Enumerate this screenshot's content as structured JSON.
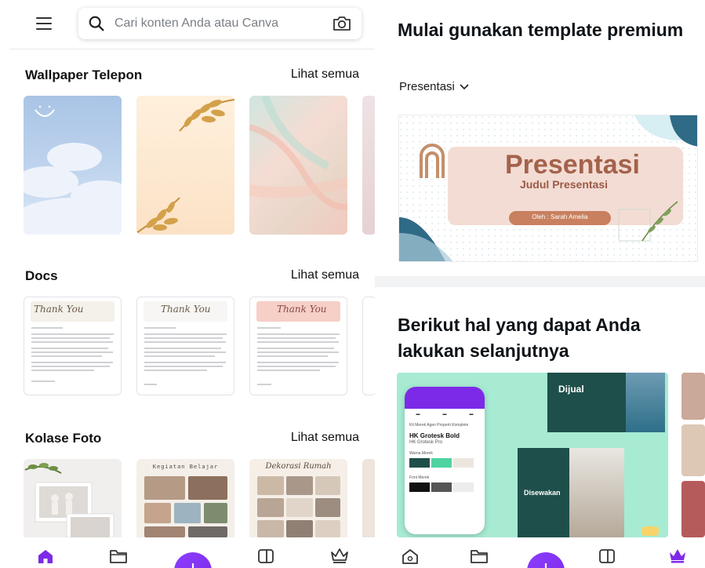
{
  "left": {
    "search": {
      "placeholder": "Cari konten Anda atau Canva"
    },
    "sections": [
      {
        "title": "Wallpaper Telepon",
        "see_all": "Lihat semua"
      },
      {
        "title": "Docs",
        "see_all": "Lihat semua"
      },
      {
        "title": "Kolase Foto",
        "see_all": "Lihat semua"
      }
    ],
    "docs": [
      {
        "script": "Thank You"
      },
      {
        "script": "Thank You"
      },
      {
        "script": "Thank You"
      }
    ],
    "collage": [
      {
        "header": ""
      },
      {
        "header": "Kegiatan Belajar"
      },
      {
        "header": "Dekorasi Rumah"
      }
    ]
  },
  "right": {
    "title": "Mulai gunakan template premium",
    "filter": "Presentasi",
    "presentation": {
      "title": "Presentasi",
      "subtitle": "Judul Presentasi",
      "author": "Oleh : Sarah Amelia"
    },
    "next_title": "Berikut hal yang dapat Anda lakukan selanjutnya",
    "mockup": {
      "sale_label": "Dijual",
      "rent_label": "Disewakan",
      "font_name": "HK Grotesk Bold",
      "font_sub": "HK Grotesk Pro",
      "brand_color_label": "Warna Merek",
      "font_label": "Font Merek",
      "kit_label": "Kit Merek Agen Properti Komplete"
    }
  },
  "colors": {
    "accent": "#8b3dff",
    "mint": "#a7ebd3",
    "dark_teal": "#1f4f4a"
  }
}
